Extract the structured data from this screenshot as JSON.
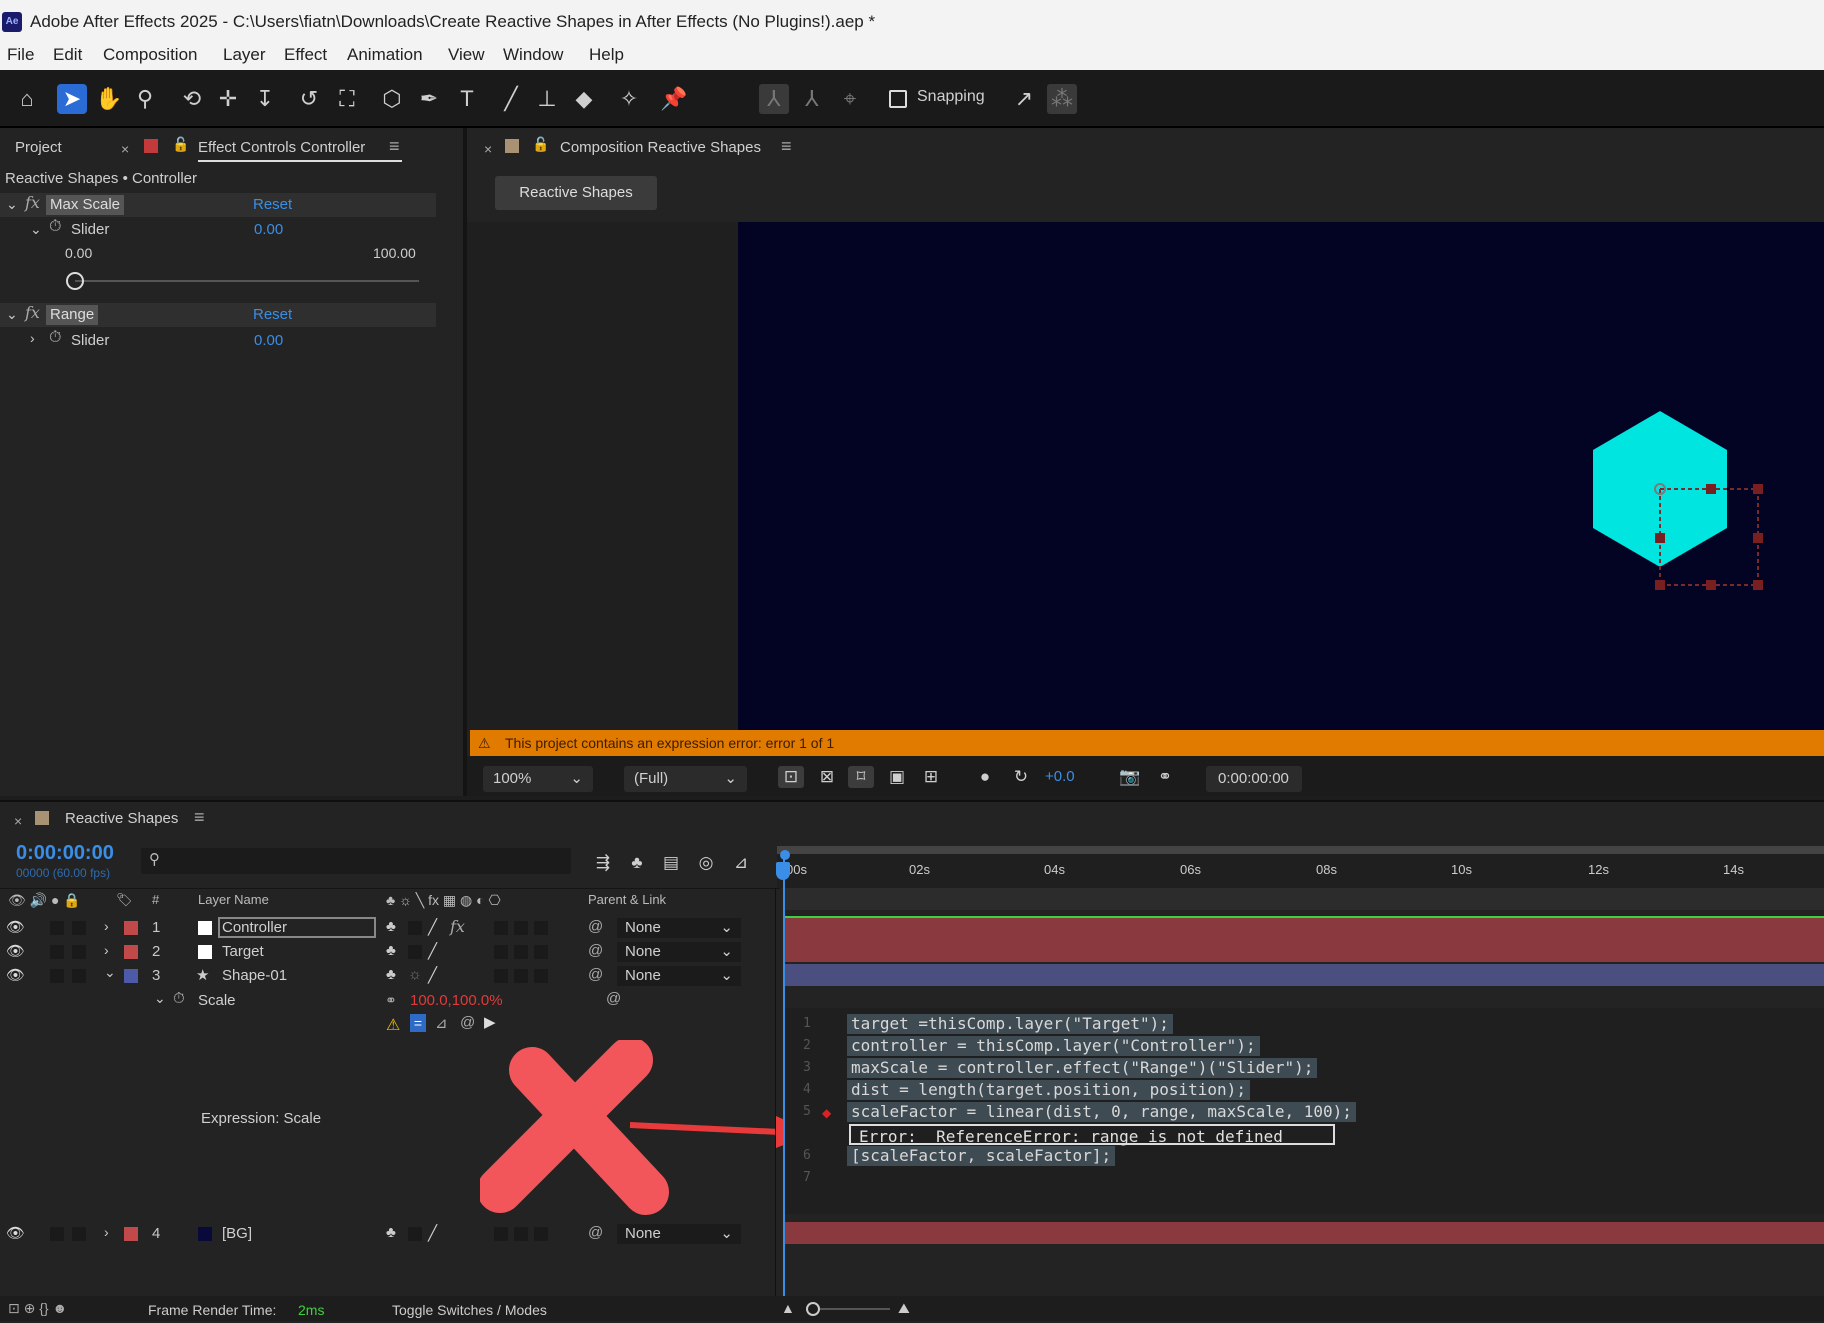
{
  "window": {
    "app_logo": "Ae",
    "title": "Adobe After Effects 2025 - C:\\Users\\fiatn\\Downloads\\Create Reactive Shapes in After Effects (No Plugins!).aep *"
  },
  "menu": [
    "File",
    "Edit",
    "Composition",
    "Layer",
    "Effect",
    "Animation",
    "View",
    "Window",
    "Help"
  ],
  "toolbar": {
    "snapping_label": "Snapping"
  },
  "left_panel": {
    "tab_project": "Project",
    "tab_effect_controls": "Effect Controls Controller",
    "breadcrumb": "Reactive Shapes • Controller",
    "effects": [
      {
        "name": "Max Scale",
        "reset": "Reset",
        "prop": "Slider",
        "value": "0.00",
        "min": "0.00",
        "max": "100.00",
        "slider_fraction": 0.0
      },
      {
        "name": "Range",
        "reset": "Reset",
        "prop": "Slider",
        "value": "0.00"
      }
    ]
  },
  "comp_panel": {
    "tab_label": "Composition Reactive Shapes",
    "comp_button": "Reactive Shapes",
    "warning": "This project contains an expression error: error 1 of 1",
    "zoom": "100%",
    "resolution": "(Full)",
    "exposure": "+0.0",
    "timecode": "0:00:00:00",
    "shape_color": "#00e5e0",
    "canvas_color": "#030324"
  },
  "timeline": {
    "tab_label": "Reactive Shapes",
    "timecode": "0:00:00:00",
    "frame_info": "00000 (60.00 fps)",
    "search_placeholder": "",
    "col_layer_name": "Layer Name",
    "col_parent": "Parent & Link",
    "col_num": "#",
    "ruler": [
      "00s",
      "02s",
      "04s",
      "06s",
      "08s",
      "10s",
      "12s",
      "14s"
    ],
    "layers": [
      {
        "num": "1",
        "name": "Controller",
        "label_color": "#c04a4a",
        "swatch": "#ffffff",
        "parent": "None",
        "track_color": "#8a3a3f"
      },
      {
        "num": "2",
        "name": "Target",
        "label_color": "#c04a4a",
        "swatch": "#ffffff",
        "parent": "None",
        "track_color": "#8a3a3f"
      },
      {
        "num": "3",
        "name": "Shape-01",
        "label_color": "#4d5aa8",
        "swatch": "star",
        "parent": "None",
        "track_color": "#4a4f80"
      },
      {
        "num": "4",
        "name": "[BG]",
        "label_color": "#c04a4a",
        "swatch": "#0a0a3a",
        "parent": "None",
        "track_color": "#8a3a3f"
      }
    ],
    "scale_prop": {
      "name": "Scale",
      "value": "100.0,100.0%"
    },
    "expression_label": "Expression: Scale",
    "code_lines": [
      "target =thisComp.layer(\"Target\");",
      "controller = thisComp.layer(\"Controller\");",
      "maxScale = controller.effect(\"Range\")(\"Slider\");",
      "dist = length(target.position, position);",
      "scaleFactor = linear(dist, 0, range, maxScale, 100);",
      "[scaleFactor, scaleFactor];"
    ],
    "line_numbers": [
      "1",
      "2",
      "3",
      "4",
      "5",
      "6",
      "7"
    ],
    "error_text": "Error:  ReferenceError: range is not defined"
  },
  "status": {
    "frame_render_label": "Frame Render Time:",
    "frame_render_value": "2ms",
    "toggle_label": "Toggle Switches / Modes"
  }
}
